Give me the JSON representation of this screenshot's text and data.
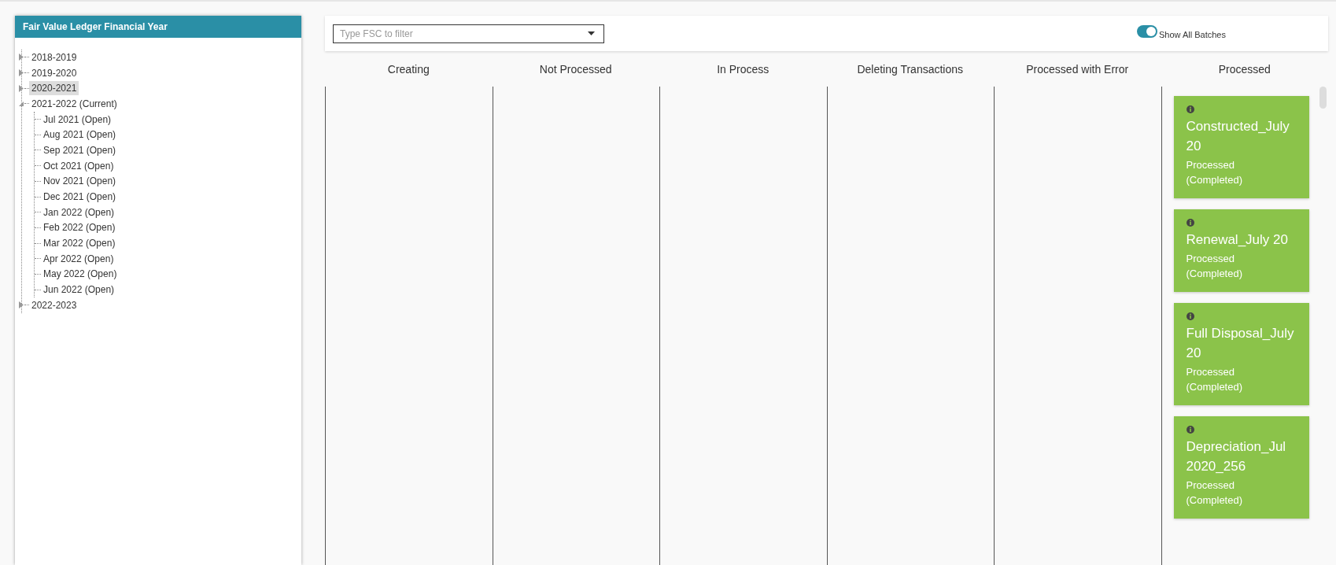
{
  "panel": {
    "title": "Fair Value Ledger Financial Year"
  },
  "tree": [
    {
      "label": "2018-2019",
      "expanded": false,
      "selected": false
    },
    {
      "label": "2019-2020",
      "expanded": false,
      "selected": false
    },
    {
      "label": "2020-2021",
      "expanded": false,
      "selected": true
    },
    {
      "label": "2021-2022 (Current)",
      "expanded": true,
      "selected": false,
      "children": [
        {
          "label": "Jul 2021 (Open)",
          "selected": false
        },
        {
          "label": "Aug 2021 (Open)",
          "selected": false
        },
        {
          "label": "Sep 2021 (Open)",
          "selected": false
        },
        {
          "label": "Oct 2021 (Open)",
          "selected": false
        },
        {
          "label": "Nov 2021 (Open)",
          "selected": false
        },
        {
          "label": "Dec 2021 (Open)",
          "selected": false
        },
        {
          "label": "Jan 2022 (Open)",
          "selected": false
        },
        {
          "label": "Feb 2022 (Open)",
          "selected": false
        },
        {
          "label": "Mar 2022 (Open)",
          "selected": false
        },
        {
          "label": "Apr 2022 (Open)",
          "selected": false
        },
        {
          "label": "May 2022 (Open)",
          "selected": false
        },
        {
          "label": "Jun 2022 (Open)",
          "selected": false
        }
      ]
    },
    {
      "label": "2022-2023",
      "expanded": false,
      "selected": false
    }
  ],
  "filter": {
    "placeholder": "Type FSC to filter"
  },
  "toggle": {
    "label": "Show All Batches",
    "on": true
  },
  "columns": [
    {
      "title": "Creating"
    },
    {
      "title": "Not Processed"
    },
    {
      "title": "In Process"
    },
    {
      "title": "Deleting Transactions"
    },
    {
      "title": "Processed with Error"
    },
    {
      "title": "Processed",
      "cards": [
        {
          "title": "Constructed_July 20",
          "status": "Processed (Completed)"
        },
        {
          "title": "Renewal_July 20",
          "status": "Processed (Completed)"
        },
        {
          "title": "Full Disposal_July 20",
          "status": "Processed (Completed)"
        },
        {
          "title": "Depreciation_Jul 2020_256",
          "status": "Processed (Completed)"
        }
      ]
    }
  ]
}
